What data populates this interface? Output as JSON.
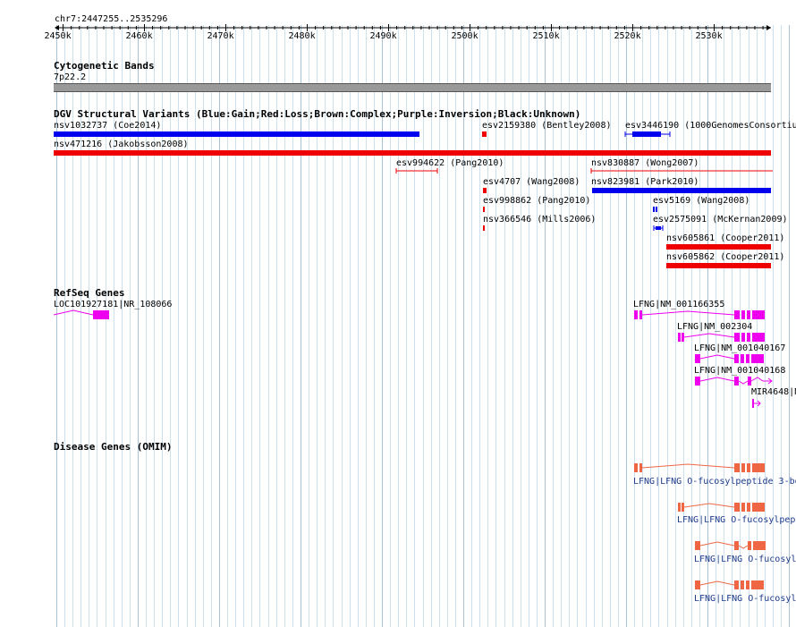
{
  "locus": "chr7:2447255..2535296",
  "ruler": {
    "ticks": [
      "2450k",
      "2460k",
      "2470k",
      "2480k",
      "2490k",
      "2500k",
      "2510k",
      "2520k",
      "2530k"
    ]
  },
  "tracks": {
    "cytoband": {
      "title": "Cytogenetic Bands",
      "band": "7p22.2"
    },
    "dgv": {
      "title": "DGV Structural Variants (Blue:Gain;Red:Loss;Brown:Complex;Purple:Inversion;Black:Unknown)",
      "features": [
        {
          "label": "nsv1032737 (Coe2014)",
          "color": "#0000ee"
        },
        {
          "label": "esv2159380 (Bentley2008)",
          "color": "#ee0000"
        },
        {
          "label": "esv3446190 (1000GenomesConsortiu",
          "color": "#0000ee"
        },
        {
          "label": "nsv471216 (Jakobsson2008)",
          "color": "#ee0000"
        },
        {
          "label": "esv994622 (Pang2010)",
          "color": "#ee0000"
        },
        {
          "label": "nsv830887 (Wong2007)",
          "color": "#ee0000"
        },
        {
          "label": "esv4707 (Wang2008)",
          "color": "#ee0000"
        },
        {
          "label": "nsv823981 (Park2010)",
          "color": "#0000ee"
        },
        {
          "label": "esv998862 (Pang2010)",
          "color": "#ee0000"
        },
        {
          "label": "esv5169 (Wang2008)",
          "color": "#0000ee"
        },
        {
          "label": "nsv366546 (Mills2006)",
          "color": "#ee0000"
        },
        {
          "label": "esv2575091 (McKernan2009)",
          "color": "#0000ee"
        },
        {
          "label": "nsv605861 (Cooper2011)",
          "color": "#ee0000"
        },
        {
          "label": "nsv605862 (Cooper2011)",
          "color": "#ee0000"
        }
      ]
    },
    "refseq": {
      "title": "RefSeq Genes",
      "color": "#ee00ee",
      "features": [
        {
          "label": "LOC101927181|NR_108066"
        },
        {
          "label": "LFNG|NM_001166355"
        },
        {
          "label": "LFNG|NM_002304"
        },
        {
          "label": "LFNG|NM_001040167"
        },
        {
          "label": "LFNG|NM_001040168"
        },
        {
          "label": "MIR4648|N"
        }
      ]
    },
    "omim": {
      "title": "Disease Genes (OMIM)",
      "color": "#ee6644",
      "features": [
        {
          "label": "LFNG|LFNG O-fucosylpeptide 3-be"
        },
        {
          "label": "LFNG|LFNG O-fucosylpep"
        },
        {
          "label": "LFNG|LFNG O-fucosyl"
        },
        {
          "label": "LFNG|LFNG O-fucosyl"
        }
      ]
    }
  }
}
